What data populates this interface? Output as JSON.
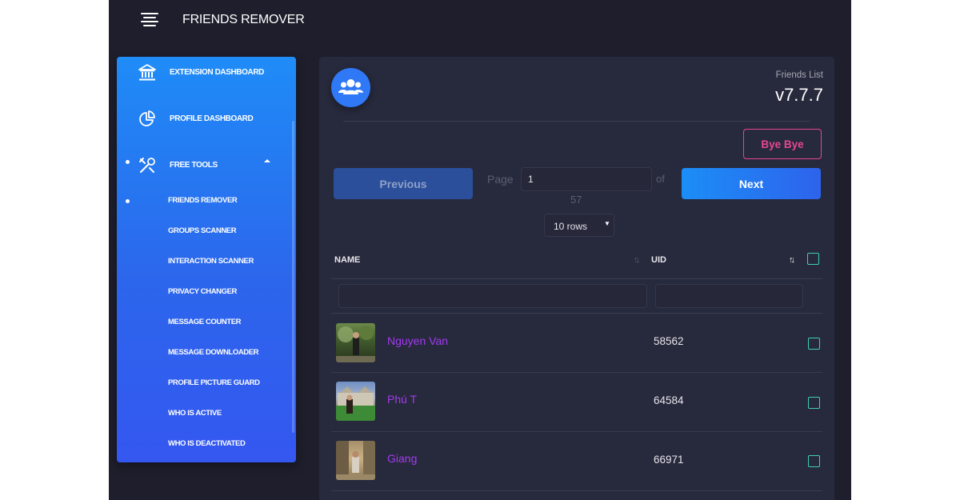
{
  "app": {
    "title": "FRIENDS REMOVER"
  },
  "sidebar": {
    "items": [
      {
        "label": "EXTENSION DASHBOARD",
        "icon": "bank-icon"
      },
      {
        "label": "PROFILE DASHBOARD",
        "icon": "pie-chart-icon"
      },
      {
        "label": "FREE TOOLS",
        "icon": "tools-icon",
        "expanded": true
      }
    ],
    "subitems": [
      {
        "label": "FRIENDS REMOVER",
        "active": true
      },
      {
        "label": "GROUPS SCANNER"
      },
      {
        "label": "INTERACTION SCANNER"
      },
      {
        "label": "PRIVACY CHANGER"
      },
      {
        "label": "MESSAGE COUNTER"
      },
      {
        "label": "MESSAGE DOWNLOADER"
      },
      {
        "label": "PROFILE PICTURE GUARD"
      },
      {
        "label": "WHO IS ACTIVE"
      },
      {
        "label": "WHO IS DEACTIVATED"
      }
    ]
  },
  "panel": {
    "icon": "users-icon",
    "subtitle": "Friends List",
    "version": "v7.7.7",
    "byebye_label": "Bye Bye",
    "pagination": {
      "prev_label": "Previous",
      "next_label": "Next",
      "page_label": "Page",
      "page_value": "1",
      "of_label": "of",
      "total_pages": "57",
      "rows_select": "10 rows"
    },
    "table": {
      "columns": [
        "NAME",
        "UID"
      ],
      "rows": [
        {
          "name": "Nguyen Van",
          "uid": "58562"
        },
        {
          "name": "Phú T",
          "uid": "64584"
        },
        {
          "name": "Giang",
          "uid": "66971"
        }
      ]
    }
  },
  "colors": {
    "background": "#1e1e2c",
    "panel": "#27293c",
    "sidebar_top": "#1f8cf7",
    "sidebar_bottom": "#3457f0",
    "accent_blue": "#2e63ec",
    "bye_pink": "#e9478f",
    "checkbox_teal": "#3fd0b2",
    "name_purple": "#a33bf0"
  }
}
